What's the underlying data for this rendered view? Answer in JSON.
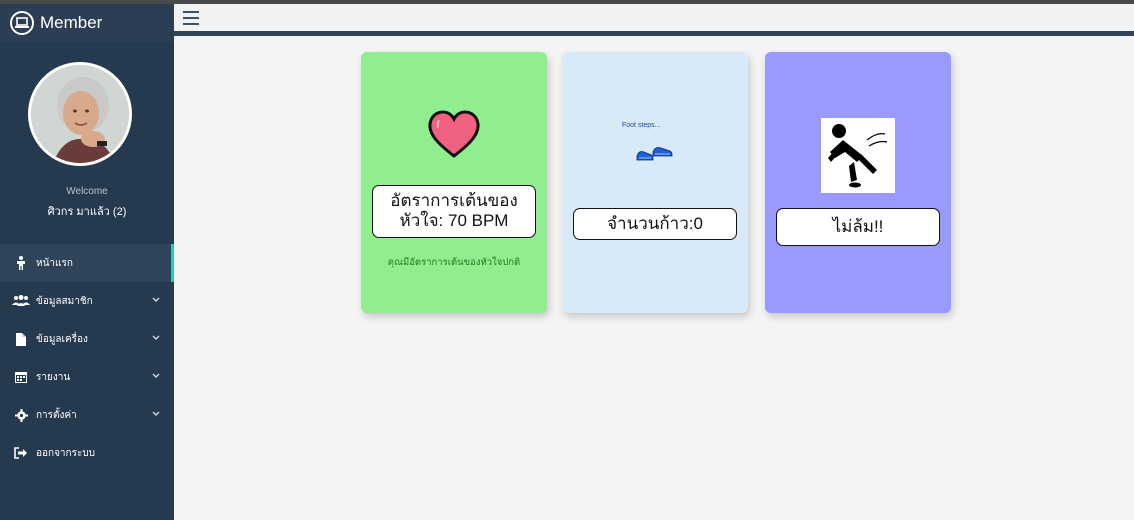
{
  "app": {
    "brand": "Member"
  },
  "user": {
    "welcome": "Welcome",
    "name": "ศิวกร มาแล้ว (2)"
  },
  "sidebar": {
    "items": [
      {
        "label": "หน้าแรก",
        "icon": "person-icon",
        "active": true,
        "has_submenu": false
      },
      {
        "label": "ข้อมูลสมาชิก",
        "icon": "users-icon",
        "active": false,
        "has_submenu": true
      },
      {
        "label": "ข้อมูลเครื่อง",
        "icon": "file-icon",
        "active": false,
        "has_submenu": true
      },
      {
        "label": "รายงาน",
        "icon": "calendar-icon",
        "active": false,
        "has_submenu": true
      },
      {
        "label": "การตั้งค่า",
        "icon": "gear-icon",
        "active": false,
        "has_submenu": true
      },
      {
        "label": "ออกจากระบบ",
        "icon": "sign-out-icon",
        "active": false,
        "has_submenu": false
      }
    ]
  },
  "cards": {
    "heart": {
      "value_line1": "อัตราการเต้นของ",
      "value_line2": "หัวใจ: 70 BPM",
      "link": "คุณมีอัตราการเต้นของหัวใจปกติ",
      "color": "#90ee90"
    },
    "steps": {
      "caption": "Foot steps...",
      "value": "จำนวนก้าว:0",
      "color": "#d8e9f8"
    },
    "fall": {
      "value": "ไม่ล้ม!!",
      "color": "#9999ff"
    }
  },
  "colors": {
    "sidebar": "#263a4f",
    "active_indicator": "#2ec4b6",
    "heart": "#f0607f"
  }
}
